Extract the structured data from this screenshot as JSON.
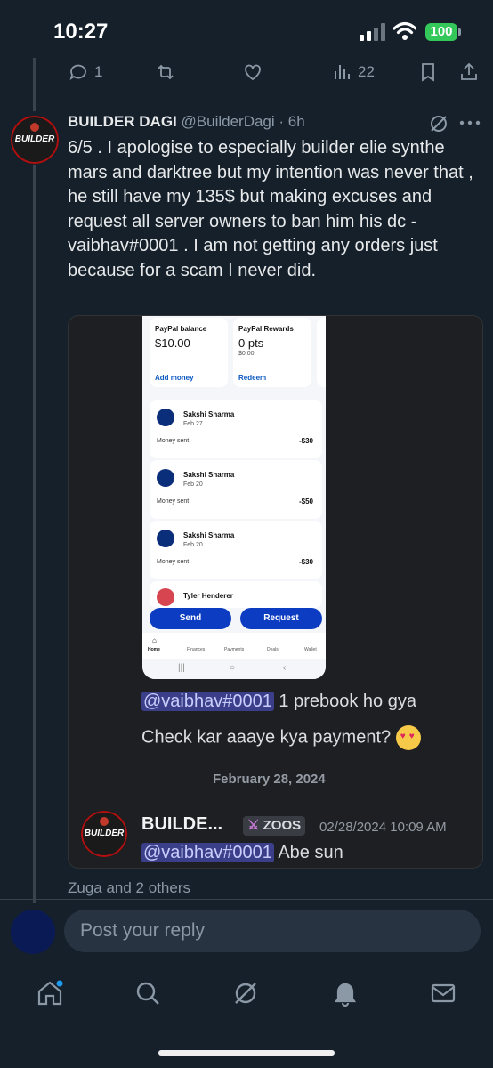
{
  "status_bar": {
    "time": "10:27",
    "battery": "100"
  },
  "action_row": {
    "replies": "1",
    "views": "22"
  },
  "tweet": {
    "author_name": "BUILDER DAGI",
    "handle_time": "@BuilderDagi · 6h",
    "avatar_text": "BUILDER",
    "body": "6/5 .  I apologise to especially builder elie synthe mars and darktree but my intention was never that , he still have my 135$ but making excuses and request all server owners to ban him his dc - vaibhav#0001 . I am not getting any orders just because for a scam I never did."
  },
  "paypal": {
    "balance_label": "PayPal balance",
    "balance_value": "$10.00",
    "balance_action": "Add money",
    "rewards_label": "PayPal Rewards",
    "rewards_value": "0 pts",
    "rewards_sub": "$0.00",
    "rewards_action": "Redeem",
    "transactions": [
      {
        "name": "Sakshi Sharma",
        "date": "Feb 27",
        "type": "Money sent",
        "amount": "-$30"
      },
      {
        "name": "Sakshi Sharma",
        "date": "Feb 20",
        "type": "Money sent",
        "amount": "-$50"
      },
      {
        "name": "Sakshi Sharma",
        "date": "Feb 20",
        "type": "Money sent",
        "amount": "-$30"
      },
      {
        "name": "Tyler Henderer"
      }
    ],
    "send_label": "Send",
    "request_label": "Request",
    "nav": [
      "Home",
      "Finances",
      "Payments",
      "Deals",
      "Wallet"
    ]
  },
  "discord": {
    "mention": "@vaibhav#0001",
    "message1_rest": "1 prebook ho gya",
    "message1_line2": "Check kar aaaye kya payment?",
    "date_divider": "February 28, 2024",
    "author": "BUILDE...",
    "tag": "ZOOS",
    "timestamp": "02/28/2024 10:09 AM",
    "message2_rest": "Abe sun"
  },
  "likes_line": "Zuga and 2 others",
  "reply": {
    "placeholder": "Post your reply"
  },
  "colors": {
    "background": "#15202b",
    "accent": "#1d9bf0",
    "paypal_blue": "#0b3cc1"
  }
}
